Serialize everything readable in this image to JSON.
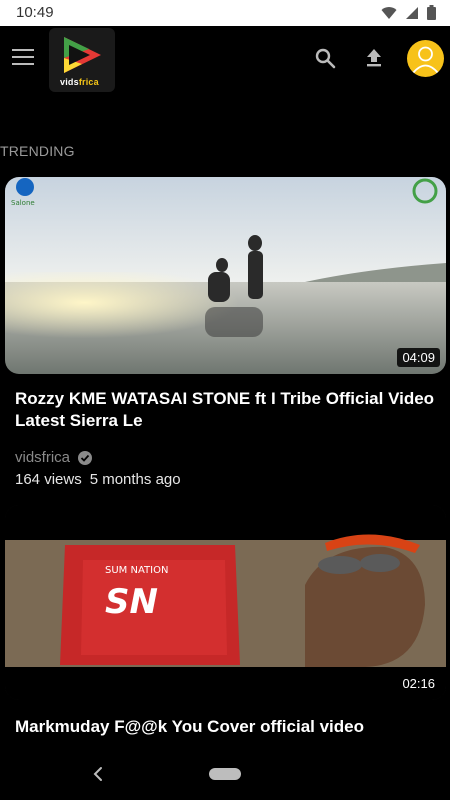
{
  "status_bar": {
    "time": "10:49"
  },
  "app_bar": {
    "logo_text_1": "vids",
    "logo_text_2": "frica"
  },
  "section": {
    "title": "TRENDING"
  },
  "videos": [
    {
      "title": "Rozzy KME WATASAI STONE ft I Tribe Official Video Latest Sierra Le",
      "duration": "04:09",
      "channel": "vidsfrica",
      "views": "164 views",
      "age": "5 months ago"
    },
    {
      "title": "Markmuday F@@k You Cover official video",
      "duration": "02:16"
    }
  ],
  "colors": {
    "accent": "#f7c21a",
    "background": "#000000"
  }
}
